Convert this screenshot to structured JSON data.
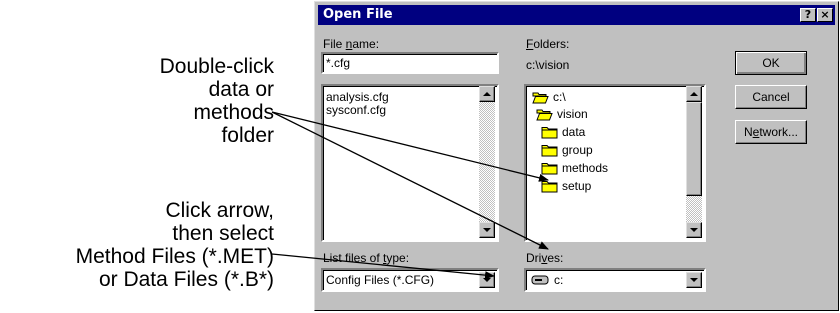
{
  "callouts": {
    "folder_lines": [
      "Double-click",
      "data or",
      "methods",
      "folder"
    ],
    "filetype_lines": [
      "Click arrow,",
      "then select",
      "Method Files (*.MET)",
      "or Data Files (*.B*)"
    ]
  },
  "dialog": {
    "title": "Open File",
    "help_btn": "?",
    "close_btn": "×",
    "filename_label_pre": "File ",
    "filename_label_u": "n",
    "filename_label_post": "ame:",
    "filename_value": "*.cfg",
    "files": [
      "analysis.cfg",
      "sysconf.cfg"
    ],
    "folders_label_u": "F",
    "folders_label_post": "olders:",
    "current_path": "c:\\vision",
    "folder_tree": [
      "c:\\",
      "vision",
      "data",
      "group",
      "methods",
      "setup"
    ],
    "filetype_label_pre": "List files of ",
    "filetype_label_u": "t",
    "filetype_label_post": "ype:",
    "filetype_value": "Config Files (*.CFG)",
    "drives_label_pre": "Dri",
    "drives_label_u": "v",
    "drives_label_post": "es:",
    "drive_value": "c:",
    "ok_label": "OK",
    "cancel_label": "Cancel",
    "network_label_pre": "N",
    "network_label_u": "e",
    "network_label_post": "twork..."
  },
  "colors": {
    "titlebar": "#000080",
    "face": "#c0c0c0",
    "folder_yellow": "#ffff00"
  }
}
